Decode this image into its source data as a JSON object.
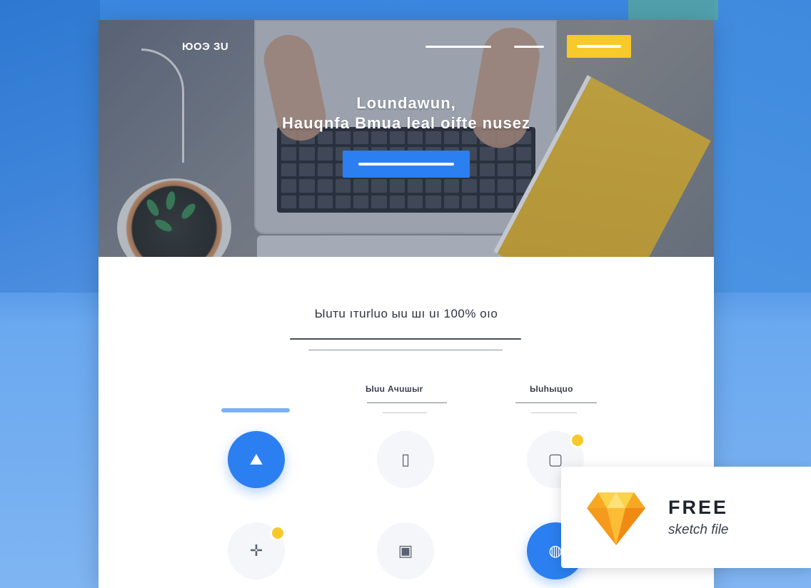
{
  "hero": {
    "logo": "ЮОЭ ЗU",
    "title_line_1": "Loundawun,",
    "title_line_2": "Hauqnfa Bmua leal oifte nusez",
    "cta_label": ""
  },
  "content": {
    "section_title": "Ыuтu ıтurluo ыu шı uı 100% oıo",
    "columns": [
      {
        "heading": "",
        "accent": true
      },
      {
        "heading": "Ыuu Ачuшыr"
      },
      {
        "heading": "Ыuhыцuo"
      }
    ]
  },
  "icons": [
    {
      "name": "upload-icon",
      "glyph": "⛰",
      "style": "blue"
    },
    {
      "name": "document-icon",
      "glyph": "▯",
      "style": "light"
    },
    {
      "name": "edit-icon",
      "glyph": "▢",
      "style": "light"
    },
    {
      "name": "move-icon",
      "glyph": "✛",
      "style": "light"
    },
    {
      "name": "image-icon",
      "glyph": "▣",
      "style": "light"
    },
    {
      "name": "globe-icon",
      "glyph": "◍",
      "style": "blue"
    }
  ],
  "promo": {
    "title": "FREE",
    "subtitle": "sketch file"
  },
  "colors": {
    "accent_blue": "#2b7ff0",
    "accent_yellow": "#f7c92b",
    "background_blue": "#3b86de"
  }
}
